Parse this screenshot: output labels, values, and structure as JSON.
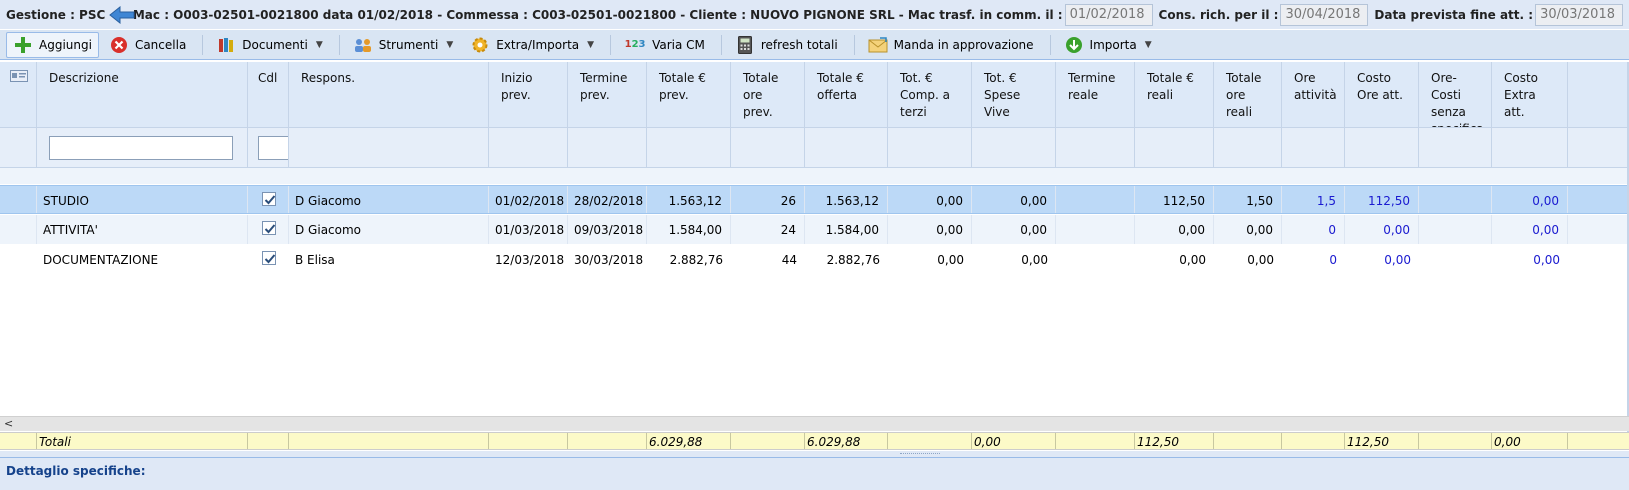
{
  "header": {
    "text1": "Gestione : PSC",
    "text2": "Mac : O003-02501-0021800 data 01/02/2018 - Commessa : C003-02501-0021800 - Cliente : NUOVO PIGNONE SRL -  Mac trasf. in comm. il :",
    "trasf_value": "01/02/2018",
    "cons_label": "Cons. rich. per il :",
    "cons_value": "30/04/2018",
    "fine_label": "Data prevista fine att. :",
    "fine_value": "30/03/2018"
  },
  "toolbar": {
    "aggiungi": "Aggiungi",
    "cancella": "Cancella",
    "documenti": "Documenti",
    "strumenti": "Strumenti",
    "extra": "Extra/Importa",
    "varia": "Varia CM",
    "refresh": "refresh totali",
    "manda": "Manda in approvazione",
    "importa": "Importa"
  },
  "columns": [
    "",
    "Descrizione",
    "Cdl",
    "Respons.",
    "Inizio prev.",
    "Termine prev.",
    "Totale € prev.",
    "Totale ore prev.",
    "Totale € offerta",
    "Tot. € Comp. a terzi",
    "Tot. € Spese Vive",
    "Termine reale",
    "Totale € reali",
    "Totale ore reali",
    "Ore attività",
    "Costo Ore att.",
    "Ore-Costi senza specifica",
    "Costo Extra att."
  ],
  "rows": [
    {
      "descrizione": "STUDIO",
      "respons": "D Giacomo",
      "inizio": "01/02/2018",
      "termine": "28/02/2018",
      "tot_prev": "1.563,12",
      "ore_prev": "26",
      "offerta": "1.563,12",
      "comp": "0,00",
      "spese": "0,00",
      "termine_reale": "",
      "reali": "112,50",
      "ore_reali": "1,50",
      "ore_att": "1,5",
      "costo_ore": "112,50",
      "senza": "",
      "extra": "0,00"
    },
    {
      "descrizione": "ATTIVITA'",
      "respons": "D Giacomo",
      "inizio": "01/03/2018",
      "termine": "09/03/2018",
      "tot_prev": "1.584,00",
      "ore_prev": "24",
      "offerta": "1.584,00",
      "comp": "0,00",
      "spese": "0,00",
      "termine_reale": "",
      "reali": "0,00",
      "ore_reali": "0,00",
      "ore_att": "0",
      "costo_ore": "0,00",
      "senza": "",
      "extra": "0,00"
    },
    {
      "descrizione": "DOCUMENTAZIONE",
      "respons": "B Elisa",
      "inizio": "12/03/2018",
      "termine": "30/03/2018",
      "tot_prev": "2.882,76",
      "ore_prev": "44",
      "offerta": "2.882,76",
      "comp": "0,00",
      "spese": "0,00",
      "termine_reale": "",
      "reali": "0,00",
      "ore_reali": "0,00",
      "ore_att": "0",
      "costo_ore": "0,00",
      "senza": "",
      "extra": "0,00"
    }
  ],
  "totals": {
    "label": "Totali",
    "tot_prev": "6.029,88",
    "offerta": "6.029,88",
    "spese": "0,00",
    "reali": "112,50",
    "costo_ore": "112,50",
    "extra": "0,00"
  },
  "scroll_left": "<",
  "detail_title": "Dettaglio specifiche:",
  "colors": {
    "header_bg": "#dfe8f6",
    "selected_row": "#bcd9f7",
    "totals_bg": "#fcfac8",
    "blue_values": "#1a1ad0"
  }
}
